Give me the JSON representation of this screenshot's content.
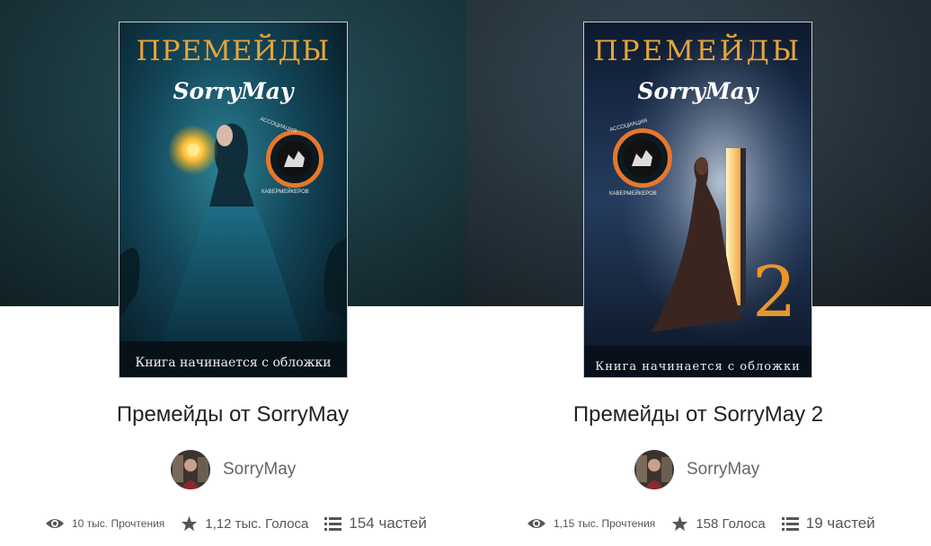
{
  "stories": [
    {
      "cover": {
        "title": "ПРЕМЕЙДЫ",
        "author": "SorryMay",
        "badge_top": "АССОЦИАЦИЯ",
        "badge_bottom": "КАВЕРМЕЙКЕРОВ",
        "tagline": "Книга начинается с обложки",
        "number": ""
      },
      "title": "Премейды от SorryMay",
      "author": "SorryMay",
      "reads": "10 тыс. Прочтения",
      "votes": "1,12 тыс. Голоса",
      "parts": "154 частей"
    },
    {
      "cover": {
        "title": "ПРЕМЕЙДЫ",
        "author": "SorryMay",
        "badge_top": "АССОЦИАЦИЯ",
        "badge_bottom": "КАВЕРМЕЙКЕРОВ",
        "tagline": "Книга начинается с обложки",
        "number": "2"
      },
      "title": "Премейды от SorryMay 2",
      "author": "SorryMay",
      "reads": "1,15 тыс. Прочтения",
      "votes": "158 Голоса",
      "parts": "19 частей"
    }
  ],
  "colors": {
    "title_gold": "#e5a53a",
    "badge_orange": "#e8772a",
    "text_dark": "#222222",
    "text_muted": "#666666"
  },
  "icons": [
    "eye-icon",
    "star-icon",
    "list-icon"
  ]
}
